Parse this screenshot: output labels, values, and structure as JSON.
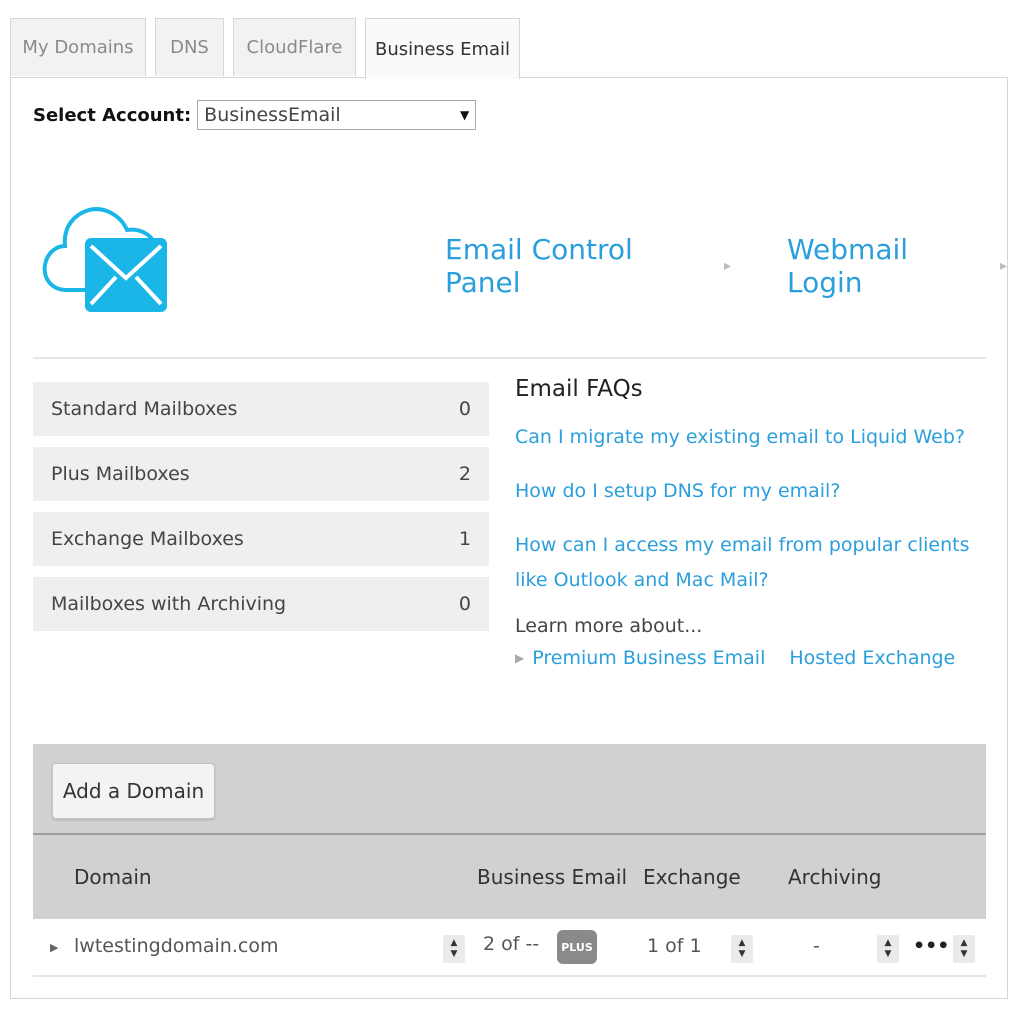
{
  "tabs": [
    "My Domains",
    "DNS",
    "CloudFlare",
    "Business Email"
  ],
  "colors": {
    "link": "#2b9fdc",
    "icon": "#1ab6e8"
  },
  "account": {
    "label": "Select Account:",
    "selected": "BusinessEmail"
  },
  "header_links": {
    "control_panel": "Email Control Panel",
    "webmail": "Webmail Login",
    "arrow": "▸"
  },
  "stats": [
    {
      "label": "Standard Mailboxes",
      "value": "0"
    },
    {
      "label": "Plus Mailboxes",
      "value": "2"
    },
    {
      "label": "Exchange Mailboxes",
      "value": "1"
    },
    {
      "label": "Mailboxes with Archiving",
      "value": "0"
    }
  ],
  "faq": {
    "title": "Email FAQs",
    "links": [
      "Can I migrate my existing email to Liquid Web?",
      "How do I setup DNS for my email?",
      "How can I access my email from popular clients like Outlook and Mac Mail?"
    ],
    "learn_more": "Learn more about...",
    "learn_links": [
      "Premium Business Email",
      "Hosted Exchange"
    ]
  },
  "toolbar": {
    "add_domain": "Add a Domain"
  },
  "table": {
    "headers": {
      "domain": "Domain",
      "business_email": "Business Email",
      "exchange": "Exchange",
      "archiving": "Archiving"
    },
    "rows": [
      {
        "domain": "lwtestingdomain.com",
        "business_email": "2 of --",
        "badge": "PLUS",
        "exchange": "1 of 1",
        "archiving": "-",
        "more": "•••"
      }
    ]
  }
}
